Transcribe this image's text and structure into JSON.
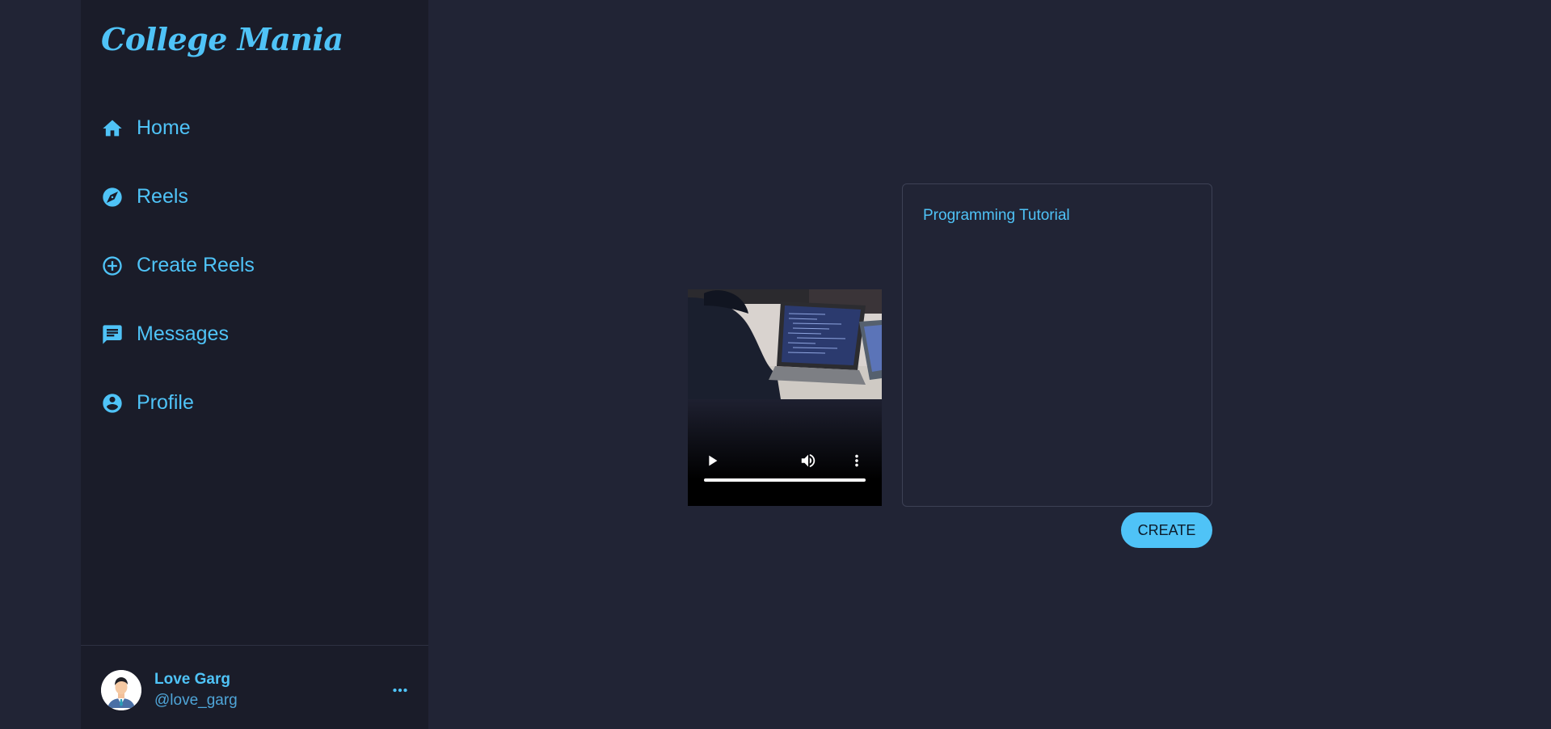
{
  "app": {
    "logo": "College Mania"
  },
  "colors": {
    "accent": "#4fc3f7",
    "background": "#212435",
    "sidebar": "#1a1c29"
  },
  "sidebar": {
    "items": [
      {
        "label": "Home",
        "icon": "home-icon"
      },
      {
        "label": "Reels",
        "icon": "compass-icon"
      },
      {
        "label": "Create Reels",
        "icon": "add-circle-icon"
      },
      {
        "label": "Messages",
        "icon": "message-icon"
      },
      {
        "label": "Profile",
        "icon": "account-circle-icon"
      }
    ]
  },
  "user": {
    "name": "Love Garg",
    "handle": "@love_garg"
  },
  "create": {
    "caption_value": "Programming Tutorial",
    "button_label": "CREATE"
  }
}
